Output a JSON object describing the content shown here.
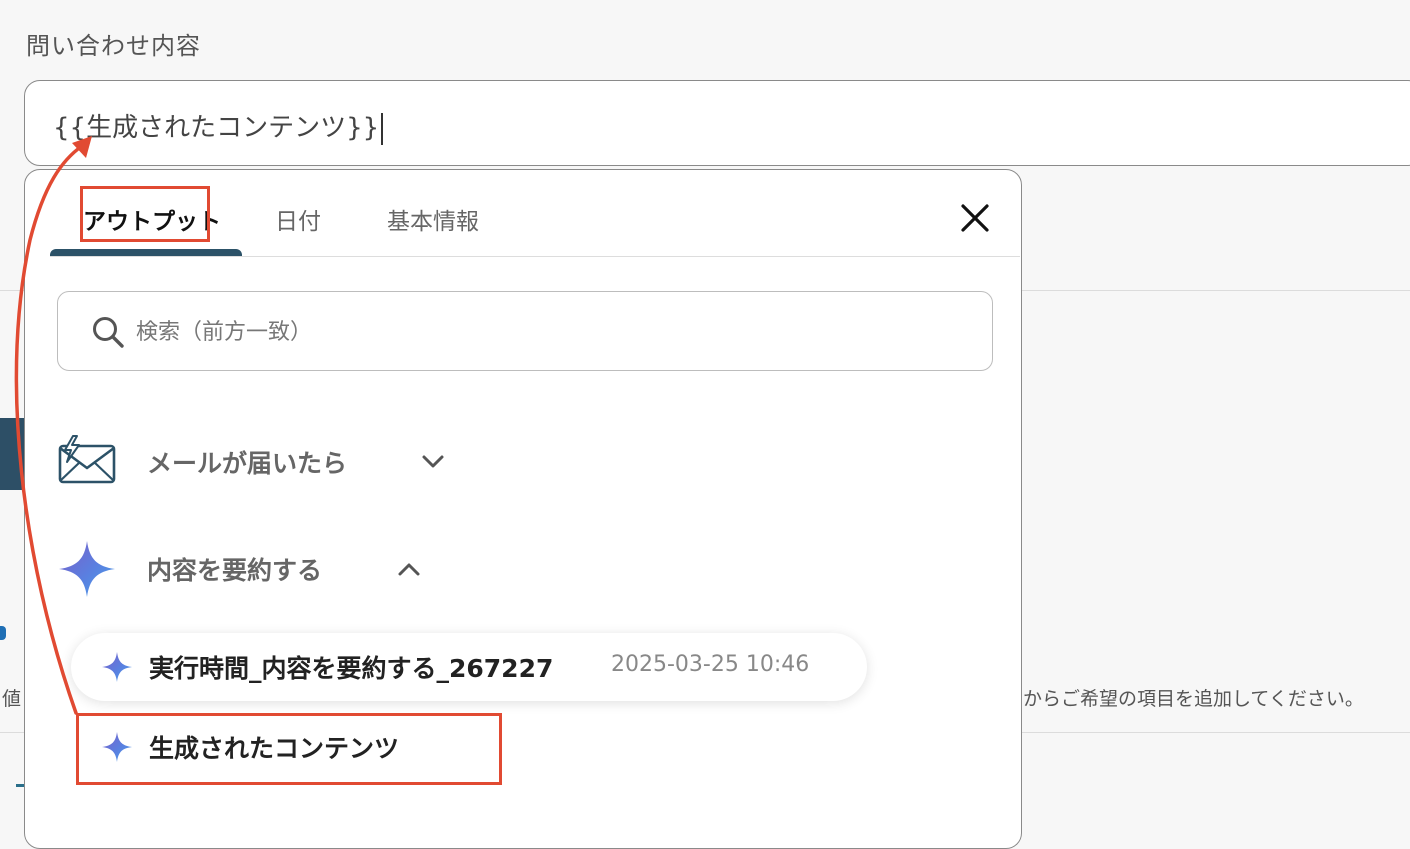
{
  "form": {
    "field_label": "問い合わせ内容",
    "input_value": "{{生成されたコンテンツ}}",
    "background_hint_text": "からご希望の項目を追加してください。",
    "background_left_char": "値"
  },
  "popup": {
    "tabs": [
      {
        "label": "アウトプット",
        "active": true
      },
      {
        "label": "日付",
        "active": false
      },
      {
        "label": "基本情報",
        "active": false
      }
    ],
    "close_icon": "close-icon",
    "search": {
      "placeholder": "検索（前方一致）",
      "value": ""
    },
    "sections": [
      {
        "label": "メールが届いたら",
        "icon": "mail-icon",
        "expanded": false
      },
      {
        "label": "内容を要約する",
        "icon": "ai-sparkle-icon",
        "expanded": true
      }
    ],
    "items": [
      {
        "name": "実行時間_内容を要約する_267227",
        "timestamp": "2025-03-25 10:46"
      },
      {
        "name": "生成されたコンテンツ",
        "timestamp": ""
      }
    ]
  },
  "colors": {
    "accent": "#2c5268",
    "annotation_red": "#e14a32",
    "sparkle_start": "#7b5fc7",
    "sparkle_end": "#4aa3e8"
  }
}
